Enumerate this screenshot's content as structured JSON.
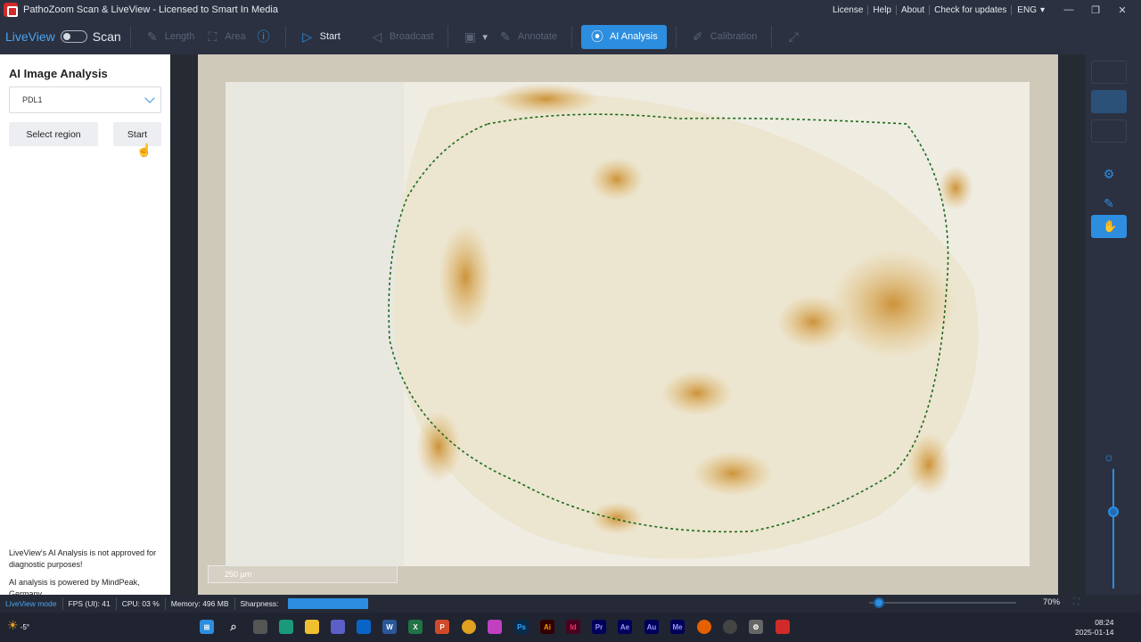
{
  "titlebar": {
    "title": "PathoZoom Scan & LiveView - Licensed to Smart In Media",
    "links": [
      "License",
      "Help",
      "About",
      "Check for updates"
    ],
    "language": "ENG",
    "min": "—",
    "max": "❐",
    "close": "✕"
  },
  "toolbar": {
    "liveview_label": "LiveView",
    "scan_label": "Scan",
    "length_label": "Length",
    "area_label": "Area",
    "start_label": "Start",
    "broadcast_label": "Broadcast",
    "annotate_label": "Annotate",
    "ai_label": "AI Analysis",
    "calibration_label": "Calibration"
  },
  "panel": {
    "title": "AI Image Analysis",
    "select_value": "PDL1",
    "select_region_label": "Select region",
    "start_label": "Start",
    "note1": "LiveView's AI Analysis is not approved for diagnostic purposes!",
    "note2": "AI analysis is powered by MindPeak, Germany"
  },
  "viewer": {
    "scale_label": "250 µm"
  },
  "status": {
    "mode": "LiveView mode",
    "fps": "FPS (UI): 41",
    "cpu": "CPU: 03 %",
    "memory": "Memory: 496   MB",
    "sharpness": "Sharpness:",
    "zoom": "70%"
  },
  "taskbar": {
    "weather": "-5°",
    "time": "08:24",
    "date": "2025-01-14"
  }
}
